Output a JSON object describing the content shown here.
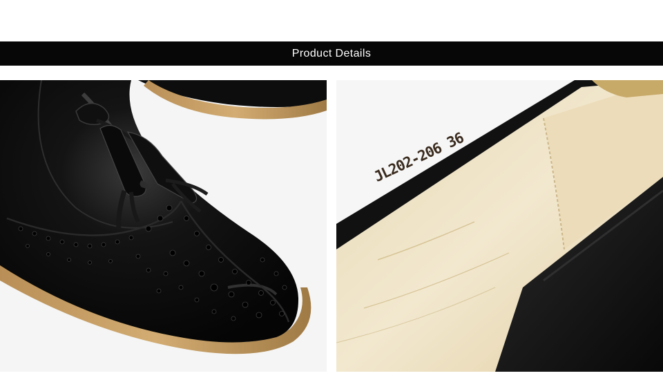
{
  "banner": {
    "title": "Product Details"
  },
  "photos": [
    {
      "subject": "black-leather-brogue-tassel-loafer-toe",
      "colors": {
        "leather": "#0b0b0b",
        "sole": "#c9a36a"
      }
    },
    {
      "subject": "shoe-insole-with-printed-size-code",
      "stamp": "JL202-206 36",
      "colors": {
        "insole": "#efe4c8",
        "suede": "#151515"
      }
    }
  ]
}
